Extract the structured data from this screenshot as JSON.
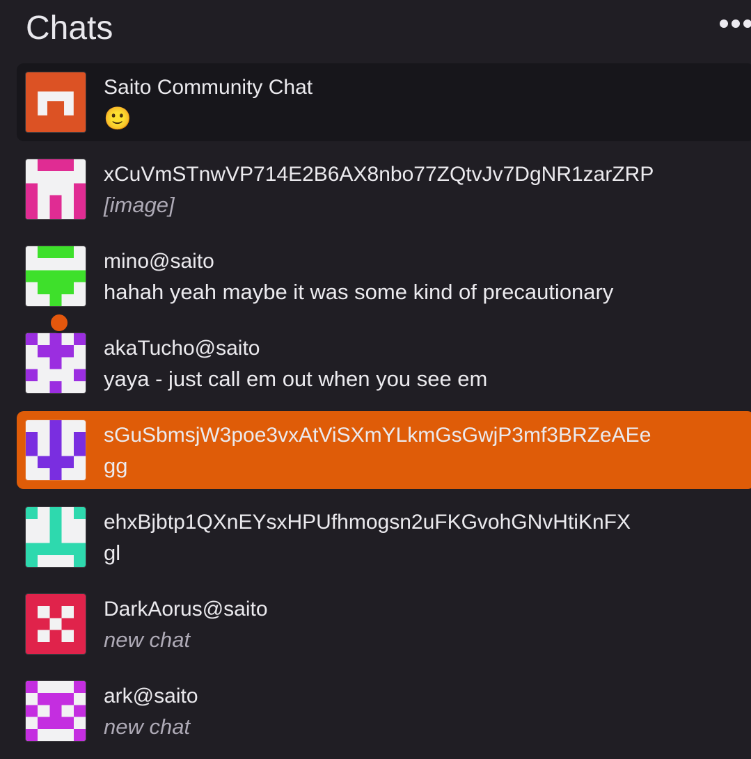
{
  "header": {
    "title": "Chats",
    "menu_icon": "more-horizontal-icon"
  },
  "chats": [
    {
      "name": "Saito Community Chat",
      "message": "🙂",
      "state": "pinned",
      "avatar_color": "#dc5224",
      "avatar_icon": "saito-logo-icon"
    },
    {
      "name": "xCuVmSTnwVP714E2B6AX8nbo77ZQtvJv7DgNR1zarZRP",
      "message": "[image]",
      "message_style": "italic",
      "avatar_color": "#e02c93"
    },
    {
      "name": "mino@saito",
      "message": "hahah yeah maybe it was some kind of precautionary",
      "avatar_color": "#3ee02b"
    },
    {
      "name": "akaTucho@saito",
      "message": "yaya - just call em out when you see em",
      "avatar_color": "#9b2ee0",
      "online_color": "#e3570d"
    },
    {
      "name": "sGuSbmsjW3poe3vxAtViSXmYLkmGsGwjP3mf3BRZeAEe",
      "message": "gg",
      "state": "active",
      "avatar_color": "#7a2ee0"
    },
    {
      "name": "ehxBjbtp1QXnEYsxHPUfhmogsn2uFKGvohGNvHtiKnFX",
      "message": "gl",
      "avatar_color": "#2ed9ae"
    },
    {
      "name": "DarkAorus@saito",
      "message": "new chat",
      "message_style": "italic",
      "avatar_color": "#e0234b"
    },
    {
      "name": "ark@saito",
      "message": "new chat",
      "message_style": "italic",
      "avatar_color": "#c42ee0"
    }
  ]
}
